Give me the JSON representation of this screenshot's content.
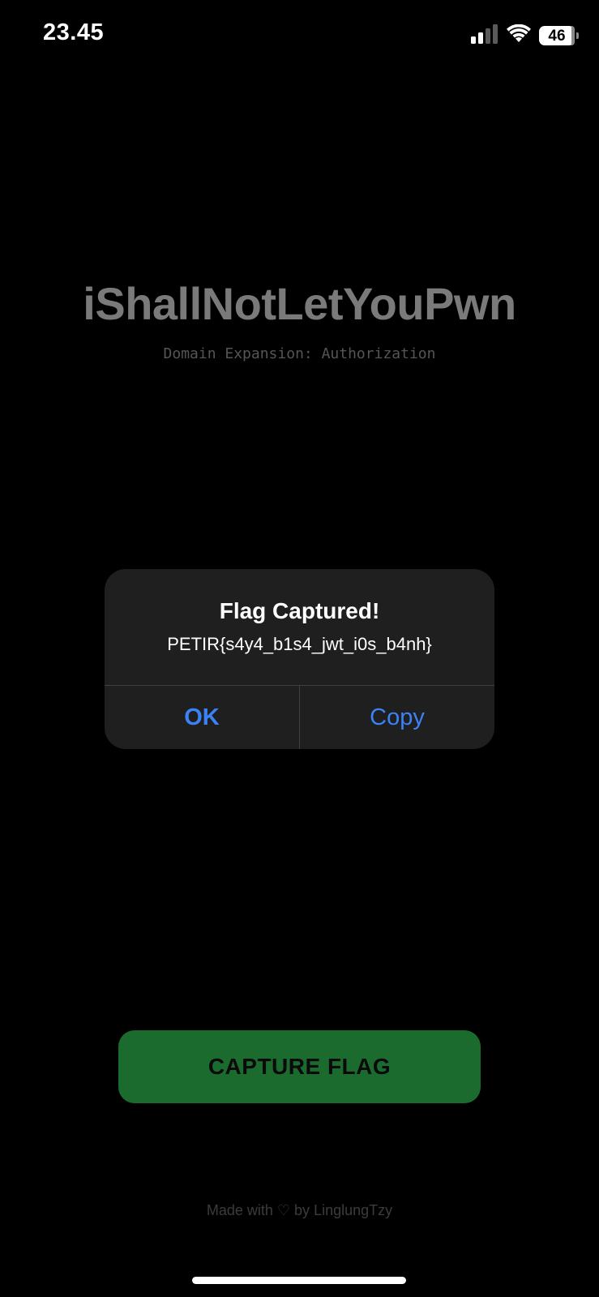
{
  "status_bar": {
    "time": "23.45",
    "battery": "46",
    "icons": [
      "cellular-signal-icon",
      "wifi-icon",
      "battery-icon"
    ]
  },
  "app": {
    "title": "iShallNotLetYouPwn",
    "subtitle": "Domain Expansion: Authorization"
  },
  "alert": {
    "title": "Flag Captured!",
    "message": "PETIR{s4y4_b1s4_jwt_i0s_b4nh}",
    "ok_label": "OK",
    "copy_label": "Copy",
    "button_color": "#3b82f6"
  },
  "main": {
    "capture_label": "CAPTURE FLAG",
    "capture_color": "#1b6b2f"
  },
  "footer": {
    "text": "Made with ♡ by LinglungTzy"
  },
  "colors": {
    "background": "#000000",
    "title": "#7a7a7a",
    "dialog": "#1f1f1f"
  }
}
